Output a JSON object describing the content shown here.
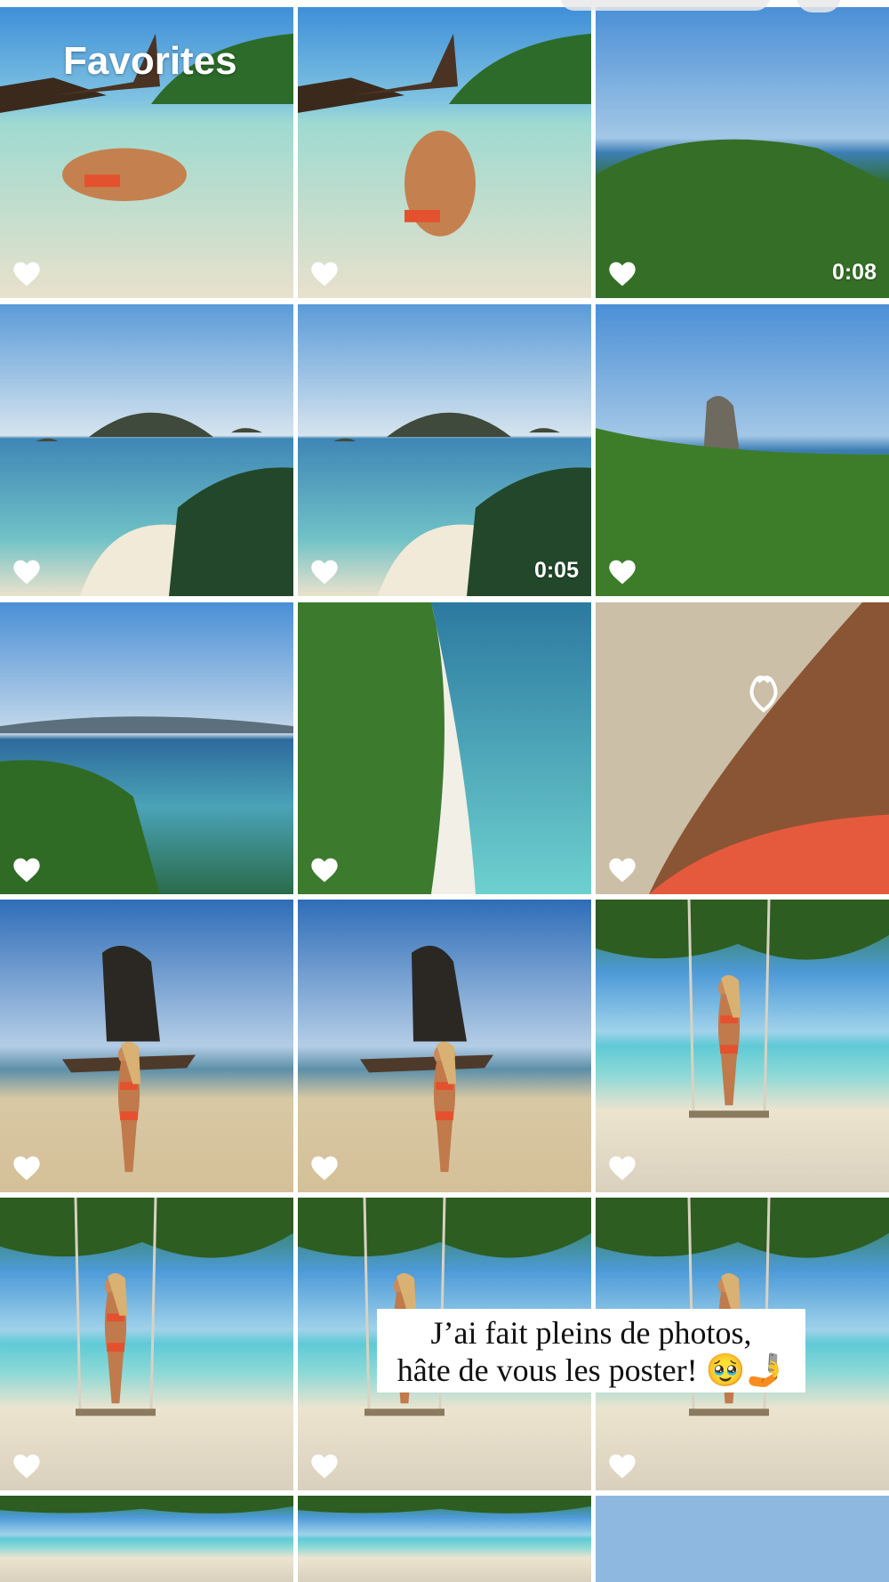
{
  "album": {
    "title": "Favorites"
  },
  "colors": {
    "divider": "#ffffff",
    "heart": "#ffffff",
    "caption_bg": "#ffffff"
  },
  "tiles": [
    {
      "scene": "woman lying in shallow water, longtail boats",
      "favorited": true,
      "duration": ""
    },
    {
      "scene": "woman sitting in shallow water, longtail boats",
      "favorited": true,
      "duration": ""
    },
    {
      "scene": "aerial view of forested island and sea",
      "favorited": true,
      "duration": "0:08"
    },
    {
      "scene": "limestone islets off white sand spit",
      "favorited": true,
      "duration": ""
    },
    {
      "scene": "limestone islets off white sand spit",
      "favorited": true,
      "duration": "0:05"
    },
    {
      "scene": "rock pinnacle rising above jungle",
      "favorited": true,
      "duration": ""
    },
    {
      "scene": "aerial view of coastline and bay",
      "favorited": true,
      "duration": ""
    },
    {
      "scene": "aerial view of beach and turquoise water",
      "favorited": true,
      "duration": ""
    },
    {
      "scene": "heart drawn in sunscreen on leg",
      "favorited": true,
      "duration": ""
    },
    {
      "scene": "woman posing on beach near rock and boats",
      "favorited": true,
      "duration": ""
    },
    {
      "scene": "woman posing on beach near rock and boats",
      "favorited": true,
      "duration": ""
    },
    {
      "scene": "woman on rope swing under tree",
      "favorited": true,
      "duration": ""
    },
    {
      "scene": "woman on rope swing under tree",
      "favorited": true,
      "duration": ""
    },
    {
      "scene": "woman on rope swing under tree",
      "favorited": true,
      "duration": ""
    },
    {
      "scene": "woman on rope swing under tree",
      "favorited": true,
      "duration": ""
    },
    {
      "scene": "tree canopy and sky",
      "favorited": false,
      "duration": ""
    },
    {
      "scene": "tree canopy and sky",
      "favorited": false,
      "duration": ""
    },
    {
      "scene": "sky",
      "favorited": false,
      "duration": ""
    }
  ],
  "caption": {
    "line1": "J’ai fait pleins de photos,",
    "line2": "hâte de vous les poster! 🥹🤳"
  }
}
